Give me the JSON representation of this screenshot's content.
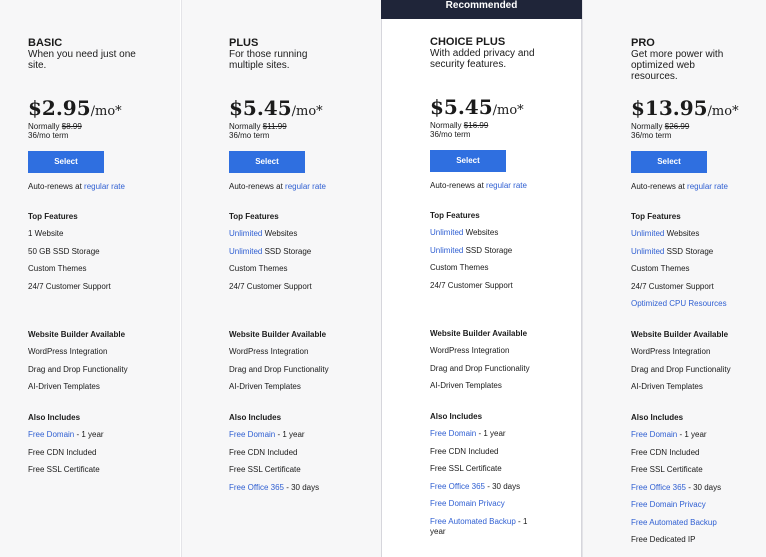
{
  "recommended_label": "Recommended",
  "plans": [
    {
      "name": "BASIC",
      "description": "When you need just one site.",
      "price": "$2.95",
      "per": "/mo*",
      "normally_label": "Normally",
      "normal_price": "$8.99",
      "term": "36/mo term",
      "select_label": "Select",
      "renew_text": "Auto-renews at",
      "renew_link": "regular rate",
      "top_features_title": "Top Features",
      "top_features": [
        {
          "link": "",
          "text": "1 Website"
        },
        {
          "link": "",
          "text": "50 GB SSD Storage"
        },
        {
          "link": "",
          "text": "Custom Themes"
        },
        {
          "link": "",
          "text": "24/7 Customer Support"
        }
      ],
      "builder_title": "Website Builder Available",
      "builder_items": [
        "WordPress Integration",
        "Drag and Drop Functionality",
        "AI-Driven Templates"
      ],
      "also_title": "Also Includes",
      "also_items": [
        {
          "link": "Free Domain",
          "text": " - 1 year"
        },
        {
          "link": "",
          "text": "Free CDN Included"
        },
        {
          "link": "",
          "text": "Free SSL Certificate"
        }
      ]
    },
    {
      "name": "PLUS",
      "description": "For those running multiple sites.",
      "price": "$5.45",
      "per": "/mo*",
      "normally_label": "Normally",
      "normal_price": "$11.99",
      "term": "36/mo term",
      "select_label": "Select",
      "renew_text": "Auto-renews at",
      "renew_link": "regular rate",
      "top_features_title": "Top Features",
      "top_features": [
        {
          "link": "Unlimited",
          "text": " Websites"
        },
        {
          "link": "Unlimited",
          "text": " SSD Storage"
        },
        {
          "link": "",
          "text": "Custom Themes"
        },
        {
          "link": "",
          "text": "24/7 Customer Support"
        }
      ],
      "builder_title": "Website Builder Available",
      "builder_items": [
        "WordPress Integration",
        "Drag and Drop Functionality",
        "AI-Driven Templates"
      ],
      "also_title": "Also Includes",
      "also_items": [
        {
          "link": "Free Domain",
          "text": " - 1 year"
        },
        {
          "link": "",
          "text": "Free CDN Included"
        },
        {
          "link": "",
          "text": "Free SSL Certificate"
        },
        {
          "link": "Free Office 365",
          "text": " - 30 days"
        }
      ]
    },
    {
      "name": "CHOICE PLUS",
      "description": "With added privacy and security features.",
      "price": "$5.45",
      "per": "/mo*",
      "normally_label": "Normally",
      "normal_price": "$16.99",
      "term": "36/mo term",
      "select_label": "Select",
      "renew_text": "Auto-renews at",
      "renew_link": "regular rate",
      "top_features_title": "Top Features",
      "top_features": [
        {
          "link": "Unlimited",
          "text": " Websites"
        },
        {
          "link": "Unlimited",
          "text": " SSD Storage"
        },
        {
          "link": "",
          "text": "Custom Themes"
        },
        {
          "link": "",
          "text": "24/7 Customer Support"
        }
      ],
      "builder_title": "Website Builder Available",
      "builder_items": [
        "WordPress Integration",
        "Drag and Drop Functionality",
        "AI-Driven Templates"
      ],
      "also_title": "Also Includes",
      "also_items": [
        {
          "link": "Free Domain",
          "text": " - 1 year"
        },
        {
          "link": "",
          "text": "Free CDN Included"
        },
        {
          "link": "",
          "text": "Free SSL Certificate"
        },
        {
          "link": "Free Office 365",
          "text": " - 30 days"
        },
        {
          "link": "Free Domain Privacy",
          "text": ""
        },
        {
          "link": "Free Automated Backup",
          "text": " - 1 year"
        }
      ]
    },
    {
      "name": "PRO",
      "description": "Get more power with optimized web resources.",
      "price": "$13.95",
      "per": "/mo*",
      "normally_label": "Normally",
      "normal_price": "$26.99",
      "term": "36/mo term",
      "select_label": "Select",
      "renew_text": "Auto-renews at",
      "renew_link": "regular rate",
      "top_features_title": "Top Features",
      "top_features": [
        {
          "link": "Unlimited",
          "text": " Websites"
        },
        {
          "link": "Unlimited",
          "text": " SSD Storage"
        },
        {
          "link": "",
          "text": "Custom Themes"
        },
        {
          "link": "",
          "text": "24/7 Customer Support"
        },
        {
          "link": "Optimized CPU Resources",
          "text": ""
        }
      ],
      "builder_title": "Website Builder Available",
      "builder_items": [
        "WordPress Integration",
        "Drag and Drop Functionality",
        "AI-Driven Templates"
      ],
      "also_title": "Also Includes",
      "also_items": [
        {
          "link": "Free Domain",
          "text": " - 1 year"
        },
        {
          "link": "",
          "text": "Free CDN Included"
        },
        {
          "link": "",
          "text": "Free SSL Certificate"
        },
        {
          "link": "Free Office 365",
          "text": " - 30 days"
        },
        {
          "link": "Free Domain Privacy",
          "text": ""
        },
        {
          "link": "Free Automated Backup",
          "text": ""
        },
        {
          "link": "",
          "text": "Free Dedicated IP"
        }
      ]
    }
  ],
  "colors": {
    "accent": "#2f6fe0",
    "link": "#2f5fd2",
    "banner": "#1f2539"
  }
}
